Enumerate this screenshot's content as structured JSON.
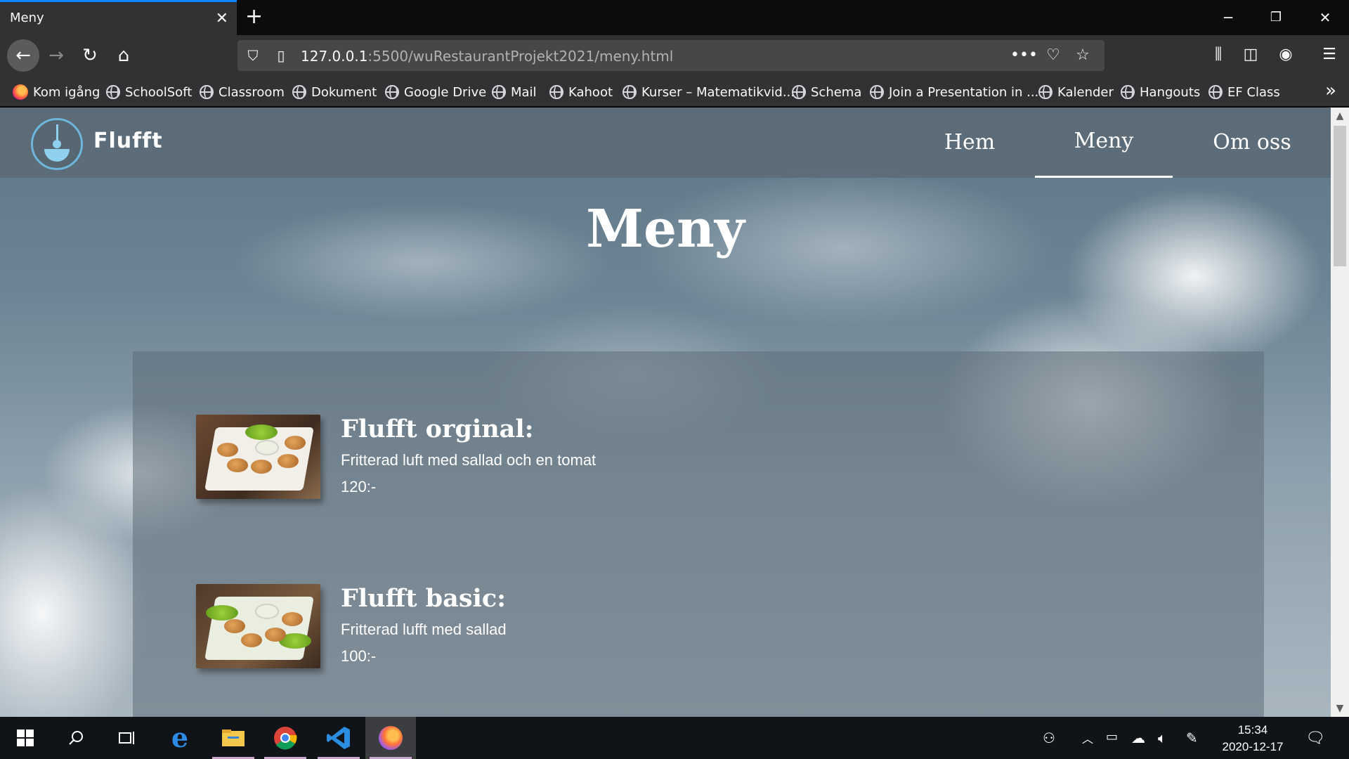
{
  "browser": {
    "tab_title": "Meny",
    "url_host": "127.0.0.1",
    "url_path": ":5500/wuRestaurantProjekt2021/meny.html",
    "bookmarks": [
      {
        "label": "Kom igång",
        "icon": "firefox-icon"
      },
      {
        "label": "SchoolSoft",
        "icon": "globe-icon"
      },
      {
        "label": "Classroom",
        "icon": "globe-icon"
      },
      {
        "label": "Dokument",
        "icon": "globe-icon"
      },
      {
        "label": "Google Drive",
        "icon": "globe-icon"
      },
      {
        "label": "Mail",
        "icon": "globe-icon"
      },
      {
        "label": "Kahoot",
        "icon": "globe-icon"
      },
      {
        "label": "Kurser – Matematikvid...",
        "icon": "globe-icon"
      },
      {
        "label": "Schema",
        "icon": "globe-icon"
      },
      {
        "label": "Join a Presentation in ...",
        "icon": "globe-icon"
      },
      {
        "label": "Kalender",
        "icon": "globe-icon"
      },
      {
        "label": "Hangouts",
        "icon": "globe-icon"
      },
      {
        "label": "EF Class",
        "icon": "globe-icon"
      }
    ]
  },
  "site": {
    "brand": "Flufft",
    "nav": [
      {
        "label": "Hem",
        "active": false
      },
      {
        "label": "Meny",
        "active": true
      },
      {
        "label": "Om oss",
        "active": false
      }
    ],
    "page_title": "Meny",
    "menu_items": [
      {
        "name": "Flufft orginal:",
        "description": "Fritterad luft med sallad och en tomat",
        "price": "120:-"
      },
      {
        "name": "Flufft basic:",
        "description": "Fritterad lufft med sallad",
        "price": "100:-"
      }
    ]
  },
  "taskbar": {
    "time": "15:34",
    "date": "2020-12-17",
    "apps": [
      "start-icon",
      "search-icon",
      "task-view-icon",
      "edge-icon",
      "file-explorer-icon",
      "chrome-icon",
      "vscode-icon",
      "firefox-icon"
    ]
  },
  "colors": {
    "accent": "#0a84ff",
    "chrome_bg": "#323234",
    "logo_blue": "#6fb6dc"
  }
}
